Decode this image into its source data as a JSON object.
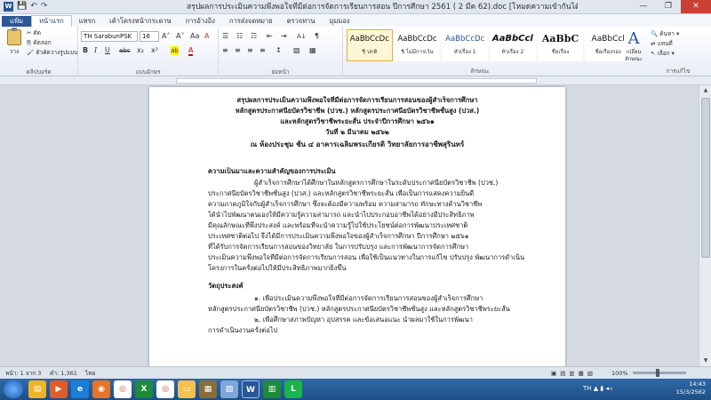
{
  "window": {
    "title": "สรุปผลการประเมินความพึงพอใจที่มีต่อการจัดการเรียนการสอน ปีการศึกษา 2561 ( 2 มีค 62).doc [โหมดความเข้ากันได้] - Microsoft Word (การเปิดใช้งานผลิตภัณฑ์ล้มเหลว)",
    "minimize": "—",
    "maximize": "❐",
    "close": "✕"
  },
  "qat": {
    "save": "💾",
    "undo": "↶",
    "redo": "↷"
  },
  "tabs": [
    "แฟ้ม",
    "หน้าแรก",
    "แทรก",
    "เค้าโครงหน้ากระดาษ",
    "การอ้างอิง",
    "การส่งจดหมาย",
    "ตรวจทาน",
    "มุมมอง"
  ],
  "ribbon": {
    "clipboard": {
      "paste": "วาง",
      "cut": "ตัด",
      "copy": "คัดลอก",
      "format_painter": "ตัวคัดวางรูปแบบ",
      "label": "คลิปบอร์ด"
    },
    "font": {
      "name": "TH SarabunPSK",
      "size": "16",
      "label": "แบบอักษร",
      "bold": "B",
      "italic": "I",
      "underline": "U",
      "strike": "abc",
      "sub": "x₂",
      "sup": "x²",
      "grow": "A˄",
      "shrink": "A˅",
      "aa": "Aa",
      "clear": "A",
      "highlight": "ab",
      "fontcolor": "A"
    },
    "paragraph": {
      "label": "ย่อหน้า",
      "bullets": "☰",
      "numbering": "☷",
      "multilevel": "☶",
      "dec_indent": "⇤",
      "inc_indent": "⇥",
      "sort": "A↓",
      "pilcrow": "¶",
      "align_left": "≡",
      "align_center": "≡",
      "align_right": "≡",
      "justify": "≡",
      "spacing": "↕",
      "shading": "▨",
      "borders": "▦"
    },
    "styles": {
      "label": "ลักษณะ",
      "items": [
        {
          "preview": "AaBbCcDc",
          "name": "¶ ปกติ",
          "selected": true
        },
        {
          "preview": "AaBbCcDc",
          "name": "¶ ไม่มีการเว้น",
          "selected": false
        },
        {
          "preview": "AaBbCcDc",
          "name": "หัวเรื่อง 1",
          "selected": false
        },
        {
          "preview": "AaBbCcl",
          "name": "หัวเรื่อง 2",
          "selected": false
        },
        {
          "preview": "AaBbC",
          "name": "ชื่อเรื่อง",
          "selected": false
        },
        {
          "preview": "AaBbCcl",
          "name": "ชื่อเรื่องรอง",
          "selected": false
        },
        {
          "preview": "AaBbCcDc",
          "name": "ตัวเน้นแบบ",
          "selected": false
        }
      ],
      "change_styles": "เปลี่ยนลักษณะ"
    },
    "editing": {
      "find": "ค้นหา ▾",
      "replace": "แทนที่",
      "select": "เลือก ▾",
      "label": "การแก้ไข"
    }
  },
  "document": {
    "title_lines": [
      "สรุปผลการประเมินความพึงพอใจที่มีต่อการจัดการเรียนการสอนของผู้สำเร็จการศึกษา",
      "หลักสูตรประกาศนียบัตรวิชาชีพ (ปวช.) หลักสูตรประกาศนียบัตรวิชาชีพชั้นสูง (ปวส.)",
      "และหลักสูตรวิชาชีพระยะสั้น ประจำปีการศึกษา ๒๕๖๑",
      "วันที่ ๒ มีนาคม ๒๕๖๒",
      "ณ ห้องประชุม ชั้น ๔ อาคารเฉลิมพระเกียรติ วิทยาลัยการอาชีพสุรินทร์"
    ],
    "section1_heading": "ความเป็นมาและความสำคัญของการประเมิน",
    "section1_lines": [
      "ผู้สำเร็จการศึกษาได้ศึกษาในหลักสูตรการศึกษาในระดับประกาศนียบัตรวิชาชีพ (ปวช.)",
      "ประกาศนียบัตรวิชาชีพชั้นสูง (ปวส.) และหลักสูตรวิชาชีพระยะสั้น เพื่อเป็นการแสดงความยินดี",
      "ความภาคภูมิใจกับผู้สำเร็จการศึกษา ซึ่งจะต้องมีความพร้อม ความสามารถ ทักษะทางด้านวิชาชีพ",
      "ได้นำไปพัฒนาตนเองให้มีความรู้ความสามารถ และนำไปประกอบอาชีพได้อย่างมีประสิทธิภาพ",
      "มีคุณลักษณะที่พึงประสงค์ และพร้อมที่จะนำความรู้ไปใช้ประโยชน์ต่อการพัฒนาประเทศชาติ",
      "ประเทศชาติต่อไป จึงได้มีการประเมินความพึงพอใจของผู้สำเร็จการศึกษา ปีการศึกษา ๒๕๖๑",
      "ที่ได้รับการจัดการเรียนการสอนของวิทยาลัย ในการปรับปรุง และการพัฒนาการจัดการศึกษา",
      "ประเมินความพึงพอใจที่มีต่อการจัดการเรียนการสอน เพื่อใช้เป็นแนวทางในการแก้ไข ปรับปรุง พัฒนาการดำเนิน",
      "โครงการในครั้งต่อไปให้มีประสิทธิภาพมากยิ่งขึ้น"
    ],
    "section2_heading": "วัตถุประสงค์",
    "section2_lines": [
      "๑. เพื่อประเมินความพึงพอใจที่มีต่อการจัดการเรียนการสอนของผู้สำเร็จการศึกษา",
      "หลักสูตรประกาศนียบัตรวิชาชีพ (ปวช.) หลักสูตรประกาศนียบัตรวิชาชีพชั้นสูง และหลักสูตรวิชาชีพระยะสั้น",
      "๒. เพื่อศึกษาสภาพปัญหา อุปสรรค และข้อเสนอแนะ นำผลมาใช้ในการพัฒนา",
      "การดำเนินงานครั้งต่อไป"
    ]
  },
  "status": {
    "page": "หน้า: 1 จาก 3",
    "words": "คำ: 1,361",
    "lang": "ไทย",
    "zoom": "100%",
    "views": "▣ ▤ ▥ ▦ ▧"
  },
  "taskbar": {
    "time": "14:43",
    "date": "15/3/2562",
    "lang": "TH"
  }
}
